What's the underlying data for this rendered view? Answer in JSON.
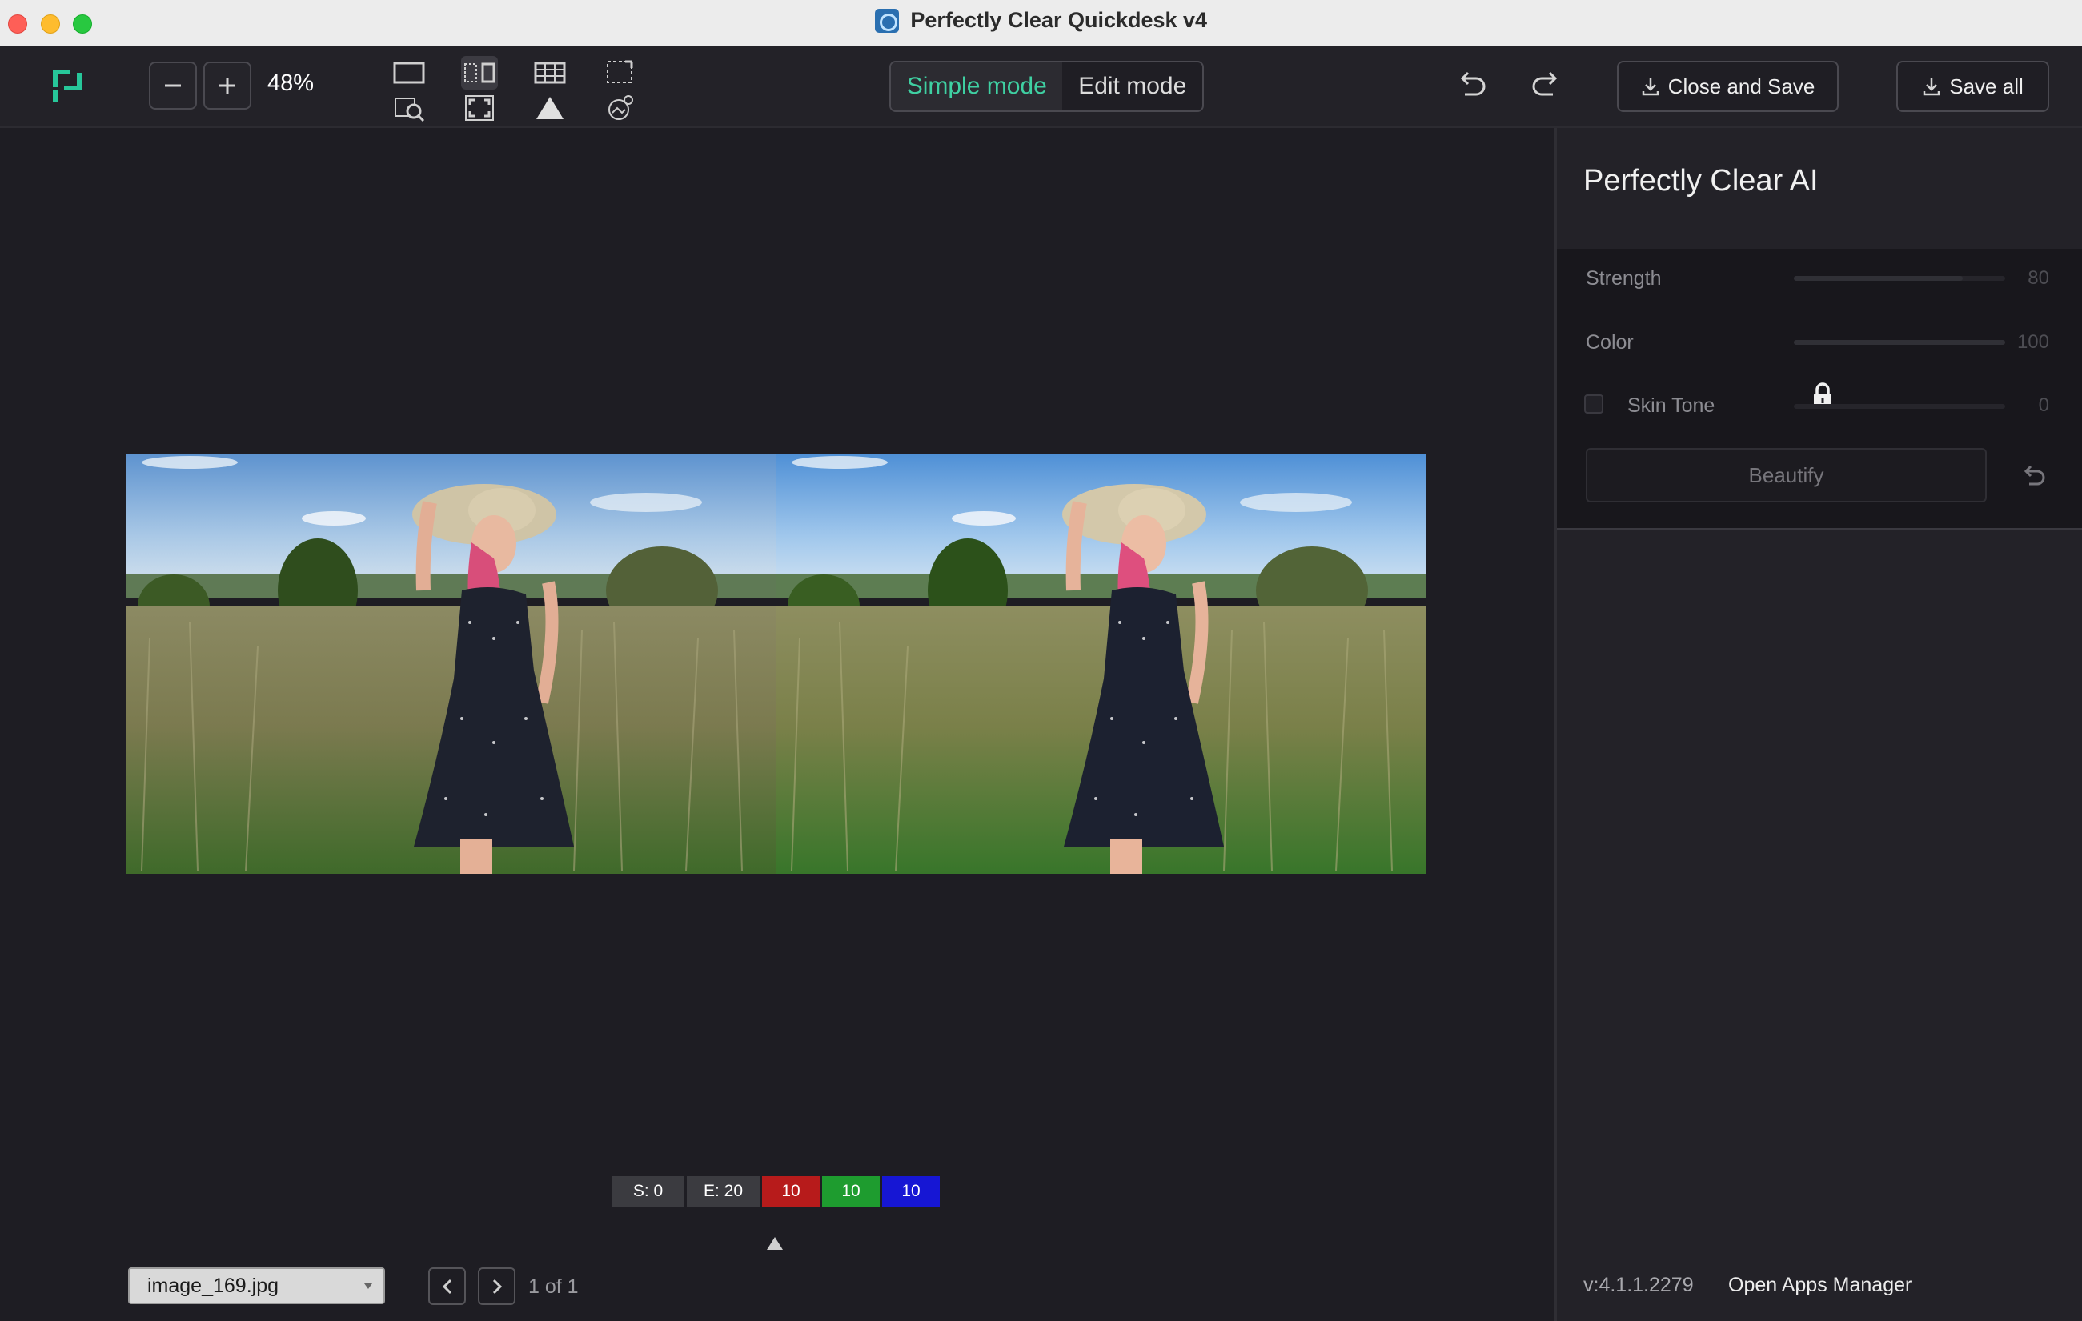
{
  "window": {
    "title": "Perfectly Clear Quickdesk v4"
  },
  "toolbar": {
    "zoom_level": "48%",
    "modes": {
      "simple": "Simple mode",
      "edit": "Edit mode",
      "active": "simple"
    },
    "close_and_save": "Close and Save",
    "save_all": "Save all",
    "view_icons": [
      "single-view-icon",
      "side-by-side-icon",
      "grid-view-icon",
      "crop-icon",
      "compare-loupe-icon",
      "fit-screen-icon",
      "histogram-triangle-icon",
      "image-tools-icon"
    ]
  },
  "canvas": {
    "stats": {
      "s": "S: 0",
      "e": "E: 20",
      "r": "10",
      "g": "10",
      "b": "10"
    },
    "file_name": "image_169.jpg",
    "page_info": "1 of 1"
  },
  "panel": {
    "title": "Perfectly Clear AI",
    "strength": {
      "label": "Strength",
      "value": "80",
      "level": 0.8
    },
    "color": {
      "label": "Color",
      "value": "100",
      "level": 1.0
    },
    "skin_tone": {
      "label": "Skin Tone",
      "value": "0",
      "level": 0.0,
      "locked": true
    },
    "beautify": "Beautify",
    "version": "v:4.1.1.2279",
    "apps_manager": "Open Apps Manager"
  },
  "colors": {
    "accent": "#3fd0a2",
    "red": "#b71b1b",
    "green": "#1e9c2f",
    "blue": "#1616d4"
  }
}
